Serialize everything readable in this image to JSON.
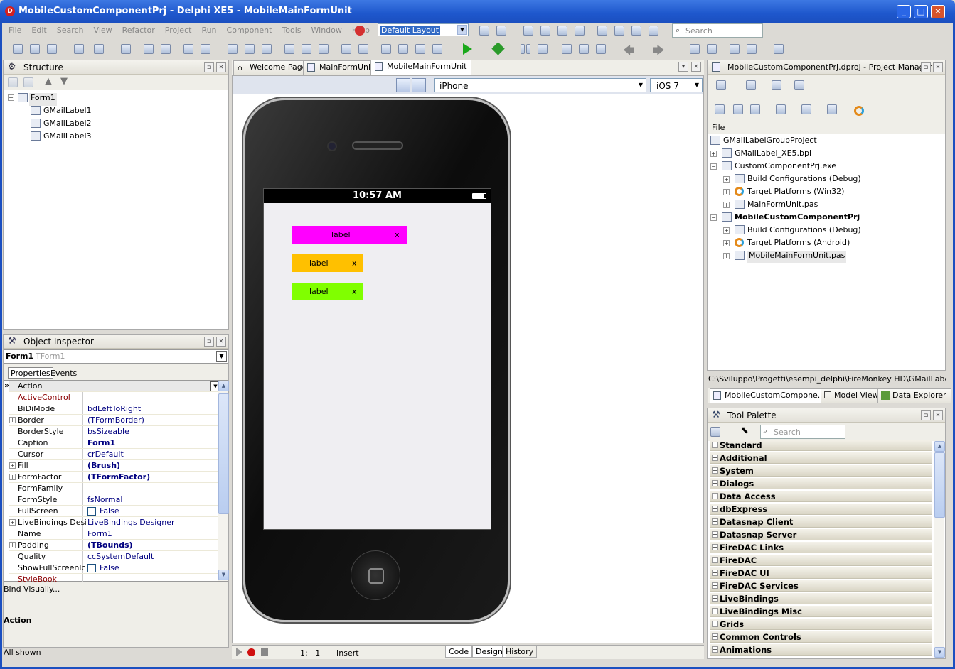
{
  "window": {
    "title": "MobileCustomComponentPrj - Delphi XE5 - MobileMainFormUnit"
  },
  "menu": [
    "File",
    "Edit",
    "Search",
    "View",
    "Refactor",
    "Project",
    "Run",
    "Component",
    "Tools",
    "Window",
    "Help"
  ],
  "layout_selector": {
    "value": "Default Layout"
  },
  "search": {
    "placeholder": "Search"
  },
  "structure": {
    "title": "Structure",
    "root": "Form1",
    "children": [
      "GMailLabel1",
      "GMailLabel2",
      "GMailLabel3"
    ]
  },
  "object_inspector": {
    "title": "Object Inspector",
    "selected": "Form1",
    "selected_type": "TForm1",
    "tabs": [
      "Properties",
      "Events"
    ],
    "rows": [
      {
        "name": "Action",
        "value": ""
      },
      {
        "name": "ActiveControl",
        "value": ""
      },
      {
        "name": "BiDiMode",
        "value": "bdLeftToRight"
      },
      {
        "name": "Border",
        "value": "(TFormBorder)"
      },
      {
        "name": "BorderStyle",
        "value": "bsSizeable"
      },
      {
        "name": "Caption",
        "value": "Form1"
      },
      {
        "name": "Cursor",
        "value": "crDefault"
      },
      {
        "name": "Fill",
        "value": "(Brush)"
      },
      {
        "name": "FormFactor",
        "value": "(TFormFactor)"
      },
      {
        "name": "FormFamily",
        "value": ""
      },
      {
        "name": "FormStyle",
        "value": "fsNormal"
      },
      {
        "name": "FullScreen",
        "value": "False"
      },
      {
        "name": "LiveBindings Designer",
        "value": "LiveBindings Designer"
      },
      {
        "name": "Name",
        "value": "Form1"
      },
      {
        "name": "Padding",
        "value": "(TBounds)"
      },
      {
        "name": "Quality",
        "value": "ccSystemDefault"
      },
      {
        "name": "ShowFullScreenIcon",
        "value": "False"
      },
      {
        "name": "StyleBook",
        "value": ""
      }
    ],
    "bind_visually": "Bind Visually...",
    "desc_title": "Action",
    "status": "All shown"
  },
  "editor": {
    "tabs": [
      "Welcome Page",
      "MainFormUnit",
      "MobileMainFormUnit"
    ],
    "device": "iPhone",
    "os": "iOS 7",
    "phone_time": "10:57 AM",
    "labels": [
      {
        "text": "label",
        "close": "x",
        "color": "#ff00ff"
      },
      {
        "text": "label",
        "close": "x",
        "color": "#ffc000"
      },
      {
        "text": "label",
        "close": "x",
        "color": "#80ff00"
      }
    ],
    "status": {
      "position": "1:   1",
      "mode": "Insert"
    },
    "bottom_tabs": [
      "Code",
      "Design",
      "History"
    ]
  },
  "project_manager": {
    "title": "MobileCustomComponentPrj.dproj - Project Manager",
    "column": "File",
    "items": [
      "GMailLabelGroupProject",
      "GMailLabel_XE5.bpl",
      "CustomComponentPrj.exe",
      "Build Configurations (Debug)",
      "Target Platforms (Win32)",
      "MainFormUnit.pas",
      "MobileCustomComponentPrj",
      "Build Configurations (Debug)",
      "Target Platforms (Android)",
      "MobileMainFormUnit.pas"
    ],
    "path": "C:\\Sviluppo\\Progetti\\esempi_delphi\\FireMonkey HD\\GMailLabelCompon",
    "tabs": [
      "MobileCustomCompone...",
      "Model View",
      "Data Explorer"
    ]
  },
  "tool_palette": {
    "title": "Tool Palette",
    "search_placeholder": "Search",
    "categories": [
      "Standard",
      "Additional",
      "System",
      "Dialogs",
      "Data Access",
      "dbExpress",
      "Datasnap Client",
      "Datasnap Server",
      "FireDAC Links",
      "FireDAC",
      "FireDAC UI",
      "FireDAC Services",
      "LiveBindings",
      "LiveBindings Misc",
      "Grids",
      "Common Controls",
      "Animations"
    ]
  }
}
